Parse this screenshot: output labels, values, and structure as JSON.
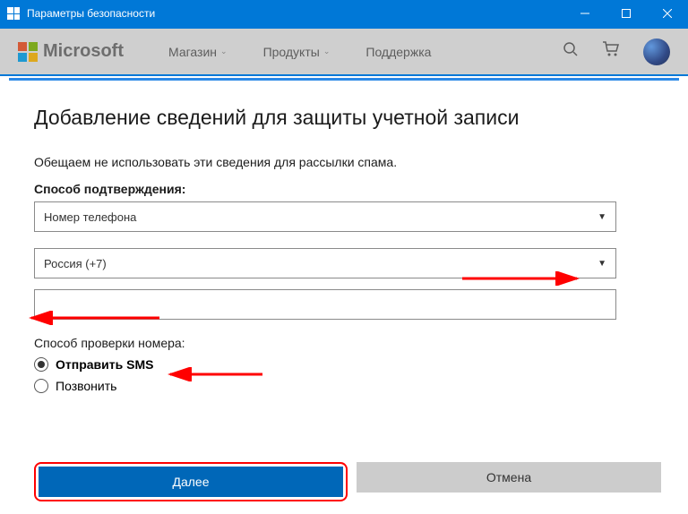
{
  "window": {
    "title": "Параметры безопасности"
  },
  "nav": {
    "brand": "Microsoft",
    "items": [
      {
        "label": "Магазин"
      },
      {
        "label": "Продукты"
      },
      {
        "label": "Поддержка"
      }
    ]
  },
  "modal": {
    "title": "Добавление сведений для защиты учетной записи",
    "subtitle": "Обещаем не использовать эти сведения для рассылки спама.",
    "verify_method_label": "Способ подтверждения:",
    "verify_method_value": "Номер телефона",
    "country_value": "Россия (+7)",
    "phone_value": "",
    "check_method_label": "Способ проверки номера:",
    "radio_sms": "Отправить SMS",
    "radio_call": "Позвонить",
    "btn_next": "Далее",
    "btn_cancel": "Отмена"
  }
}
